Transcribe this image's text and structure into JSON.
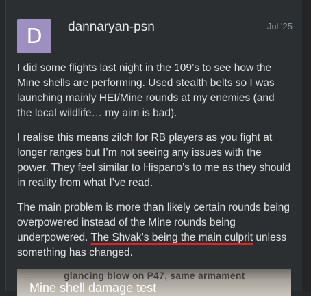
{
  "post": {
    "avatar_letter": "D",
    "avatar_color": "#9d8fbf",
    "username": "dannaryan-psn",
    "date": "Jul '25",
    "paragraphs": [
      "I did some flights last night in the 109’s to see how the Mine shells are performing. Used stealth belts so I was launching mainly HEI/Mine rounds at my enemies (and the local wildlife… my aim is bad).",
      "I realise this means zilch for RB players as you fight at longer ranges but I’m not seeing any issues with the power. They feel similar to Hispano’s to me as they should in reality from what I’ve read."
    ],
    "paragraph3": {
      "before": "The main problem is more than likely certain rounds being overpowered instead of the Mine rounds being underpowered. ",
      "underlined": "The Shvak’s being the main culprit",
      "after": " unless something has changed."
    },
    "underline_color": "#e02424",
    "image": {
      "caption": "glancing blow on P47, same armament",
      "title": "Mine shell damage test"
    }
  }
}
